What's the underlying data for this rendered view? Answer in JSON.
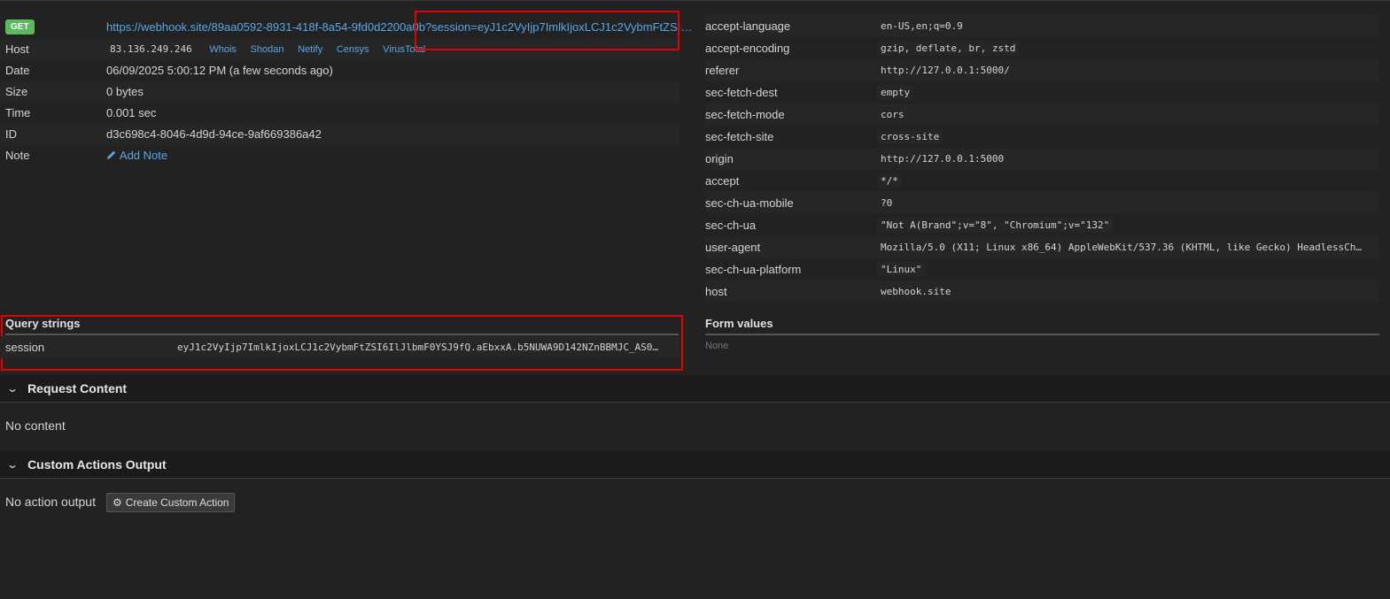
{
  "request": {
    "method": "GET",
    "url_base": "https://webhook.site/89aa0592-8931-418f-8a54-9fd0d2200a0b",
    "url_query": "?session=eyJ1c2VyIjp7ImlkIjoxLCJ1c2VybmFtZSI…",
    "rows": [
      {
        "label": "Host",
        "value": "83.136.249.246"
      },
      {
        "label": "Date",
        "value": "06/09/2025 5:00:12 PM (a few seconds ago)"
      },
      {
        "label": "Size",
        "value": "0 bytes"
      },
      {
        "label": "Time",
        "value": "0.001 sec"
      },
      {
        "label": "ID",
        "value": "d3c698c4-8046-4d9d-94ce-9af669386a42"
      },
      {
        "label": "Note",
        "value": "Add Note"
      }
    ],
    "host_links": [
      "Whois",
      "Shodan",
      "Netify",
      "Censys",
      "VirusTotal"
    ]
  },
  "headers": [
    {
      "key": "accept-language",
      "value": "en-US,en;q=0.9"
    },
    {
      "key": "accept-encoding",
      "value": "gzip, deflate, br, zstd"
    },
    {
      "key": "referer",
      "value": "http://127.0.0.1:5000/"
    },
    {
      "key": "sec-fetch-dest",
      "value": "empty"
    },
    {
      "key": "sec-fetch-mode",
      "value": "cors"
    },
    {
      "key": "sec-fetch-site",
      "value": "cross-site"
    },
    {
      "key": "origin",
      "value": "http://127.0.0.1:5000"
    },
    {
      "key": "accept",
      "value": "*/*"
    },
    {
      "key": "sec-ch-ua-mobile",
      "value": "?0"
    },
    {
      "key": "sec-ch-ua",
      "value": "\"Not A(Brand\";v=\"8\", \"Chromium\";v=\"132\""
    },
    {
      "key": "user-agent",
      "value": "Mozilla/5.0 (X11; Linux x86_64) AppleWebKit/537.36 (KHTML, like Gecko) HeadlessCh…"
    },
    {
      "key": "sec-ch-ua-platform",
      "value": "\"Linux\""
    },
    {
      "key": "host",
      "value": "webhook.site"
    }
  ],
  "query_strings": {
    "title": "Query strings",
    "items": [
      {
        "key": "session",
        "value": "eyJ1c2VyIjp7ImlkIjoxLCJ1c2VybmFtZSI6IlJlbmF0YSJ9fQ.aEbxxA.b5NUWA9D142NZnBBMJC_AS0…"
      }
    ]
  },
  "form_values": {
    "title": "Form values",
    "empty": "None"
  },
  "request_content": {
    "title": "Request Content",
    "empty": "No content"
  },
  "custom_actions": {
    "title": "Custom Actions Output",
    "empty": "No action output",
    "button": "Create Custom Action"
  },
  "colors": {
    "accent": "#5aa7e6",
    "get_badge": "#5cb85c",
    "highlight": "#e00000",
    "background": "#222222"
  },
  "icons": {
    "note": "pencil-icon",
    "button": "gear-icon",
    "section": "chevron-down-icon"
  }
}
